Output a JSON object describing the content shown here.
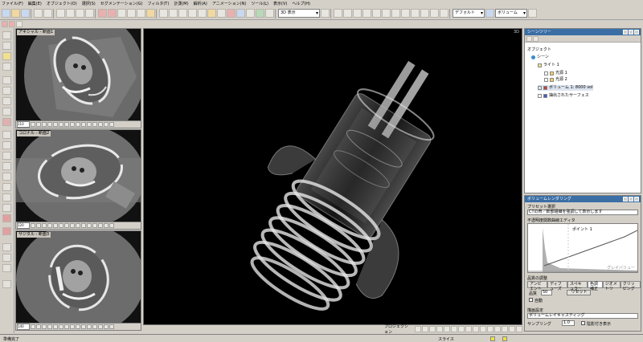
{
  "menu": [
    "ファイル(F)",
    "編集(E)",
    "オブジェクト(O)",
    "選択(S)",
    "セグメンテーション(G)",
    "フィルタ(T)",
    "計測(M)",
    "解析(A)",
    "アニメーション(N)",
    "ツール(L)",
    "表示(V)",
    "ヘルプ(H)"
  ],
  "toolbar": {
    "layout_select": "3D 表示",
    "display_select": "デフォルト",
    "volume_select": "ボリューム"
  },
  "slices": [
    {
      "title": "アキシャル - 断面1",
      "index": "110"
    },
    {
      "title": "コロナル - 断面2",
      "index": "120"
    },
    {
      "title": "サジタル - 断面3",
      "index": "140"
    }
  ],
  "view3d": {
    "label": "3D",
    "footer_mode": "プロジェクション"
  },
  "scene_panel": {
    "title": "シーンツリー",
    "subtitle": "オブジェクト",
    "items": [
      {
        "label": "シーン"
      },
      {
        "label": "ライト 1"
      },
      {
        "label": "光源 1"
      },
      {
        "label": "光源 2"
      },
      {
        "label": "ボリューム 1: 8000 vol"
      },
      {
        "label": "抽出されたサーフェス"
      }
    ]
  },
  "vr_panel": {
    "title": "ボリュームレンダリング",
    "preset_label": "プリセット選択",
    "preset_value": "CTの骨／軟部組織を強調して表示します",
    "opacity_label": "不透明度関数曲線エディタ",
    "curve_label": "グレイバリュー",
    "point_label": "ポイント 1",
    "tabs": [
      "アンビエント",
      "ディフューズ",
      "スペキュラー",
      "色調補正",
      "ジオメトリ",
      "クリッピング"
    ],
    "quality_label": "品質の調整",
    "step_label": "品質",
    "step_value": "50",
    "reset_label": "リセット",
    "check_label": "自動",
    "render_label": "描画設定",
    "render_value": "ボリュームレイキャスティング",
    "sampling_label": "サンプリング",
    "sampling_value": "1.0",
    "shading_label": "陰影付き表示"
  },
  "status": {
    "text": "準備完了",
    "value": "スライス"
  }
}
